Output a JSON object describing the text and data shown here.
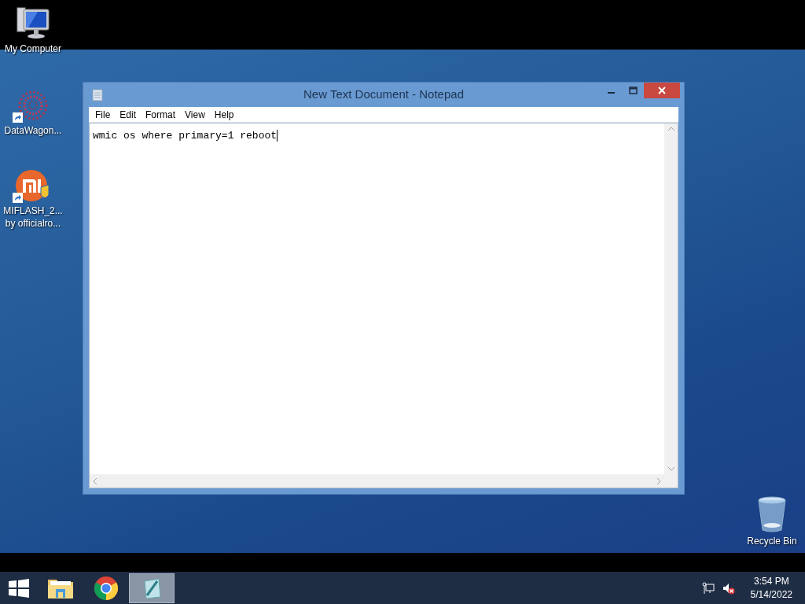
{
  "desktop_icons": [
    {
      "kind": "computer",
      "shortcut": false,
      "lines": [
        "My Computer"
      ]
    },
    {
      "kind": "datawagon",
      "shortcut": true,
      "lines": [
        "DataWagon..."
      ]
    },
    {
      "kind": "miflash",
      "shortcut": true,
      "lines": [
        "MIFLASH_2...",
        "by officialro..."
      ]
    },
    {
      "kind": "recycle",
      "shortcut": false,
      "lines": [
        "Recycle Bin"
      ]
    }
  ],
  "window": {
    "title": "New Text Document - Notepad",
    "menu": [
      "File",
      "Edit",
      "Format",
      "View",
      "Help"
    ],
    "text": "wmic os where primary=1 reboot"
  },
  "taskbar": {
    "items": [
      {
        "kind": "start",
        "selected": false
      },
      {
        "kind": "explorer",
        "selected": false
      },
      {
        "kind": "chrome",
        "selected": false
      },
      {
        "kind": "notepad",
        "selected": true
      }
    ],
    "tray": [
      {
        "kind": "network"
      },
      {
        "kind": "volume-muted"
      }
    ],
    "time": "3:54 PM",
    "date": "5/14/2022"
  }
}
